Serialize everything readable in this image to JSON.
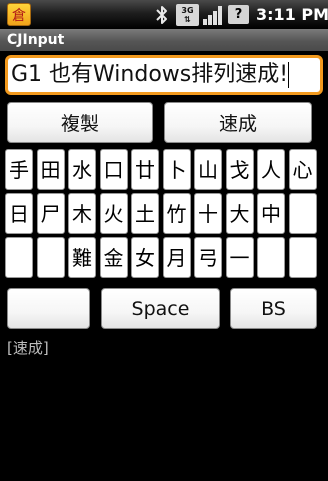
{
  "status_bar": {
    "network_label_top": "3G",
    "battery_glyph": "?",
    "time": "3:11 PM",
    "app_icon_glyph": "倉"
  },
  "title": "CJInput",
  "edit": {
    "value": "G1 也有Windows排列速成!"
  },
  "buttons": {
    "copy": "複製",
    "quick": "速成",
    "blank": "",
    "space": "Space",
    "backspace": "BS"
  },
  "keys": {
    "row1": [
      "手",
      "田",
      "水",
      "口",
      "廿",
      "卜",
      "山",
      "戈",
      "人",
      "心"
    ],
    "row2": [
      "日",
      "尸",
      "木",
      "火",
      "土",
      "竹",
      "十",
      "大",
      "中",
      ""
    ],
    "row3": [
      "",
      "",
      "難",
      "金",
      "女",
      "月",
      "弓",
      "一",
      "",
      ""
    ]
  },
  "status_line": "[速成]"
}
